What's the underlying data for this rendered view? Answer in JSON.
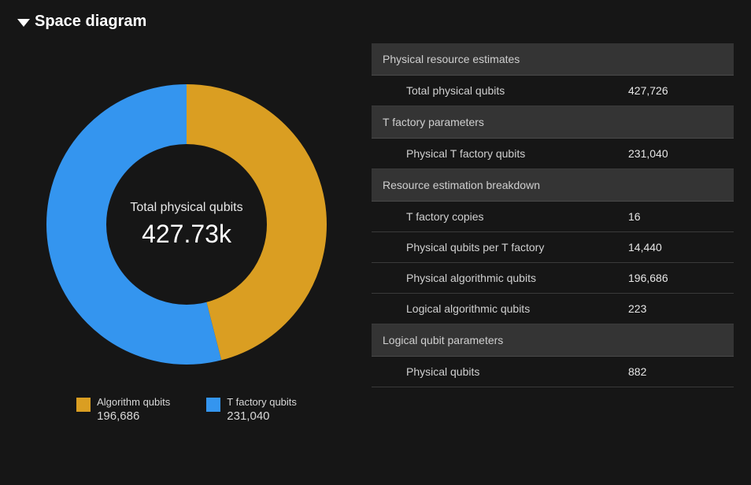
{
  "title": "Space diagram",
  "chart_data": {
    "type": "pie",
    "title": "",
    "center_label": "Total physical qubits",
    "center_value": "427.73k",
    "series": [
      {
        "name": "Algorithm qubits",
        "value": 196686,
        "color": "#da9e22"
      },
      {
        "name": "T factory qubits",
        "value": 231040,
        "color": "#3495ef"
      }
    ],
    "ylim": [
      0,
      427726
    ]
  },
  "legend": [
    {
      "label": "Algorithm qubits",
      "value": "196,686",
      "color": "#da9e22"
    },
    {
      "label": "T factory qubits",
      "value": "231,040",
      "color": "#3495ef"
    }
  ],
  "sections": [
    {
      "title": "Physical resource estimates",
      "rows": [
        {
          "label": "Total physical qubits",
          "value": "427,726"
        }
      ]
    },
    {
      "title": "T factory parameters",
      "rows": [
        {
          "label": "Physical T factory qubits",
          "value": "231,040"
        }
      ]
    },
    {
      "title": "Resource estimation breakdown",
      "rows": [
        {
          "label": "T factory copies",
          "value": "16"
        },
        {
          "label": "Physical qubits per T factory",
          "value": "14,440"
        },
        {
          "label": "Physical algorithmic qubits",
          "value": "196,686"
        },
        {
          "label": "Logical algorithmic qubits",
          "value": "223"
        }
      ]
    },
    {
      "title": "Logical qubit parameters",
      "rows": [
        {
          "label": "Physical qubits",
          "value": "882"
        }
      ]
    }
  ]
}
